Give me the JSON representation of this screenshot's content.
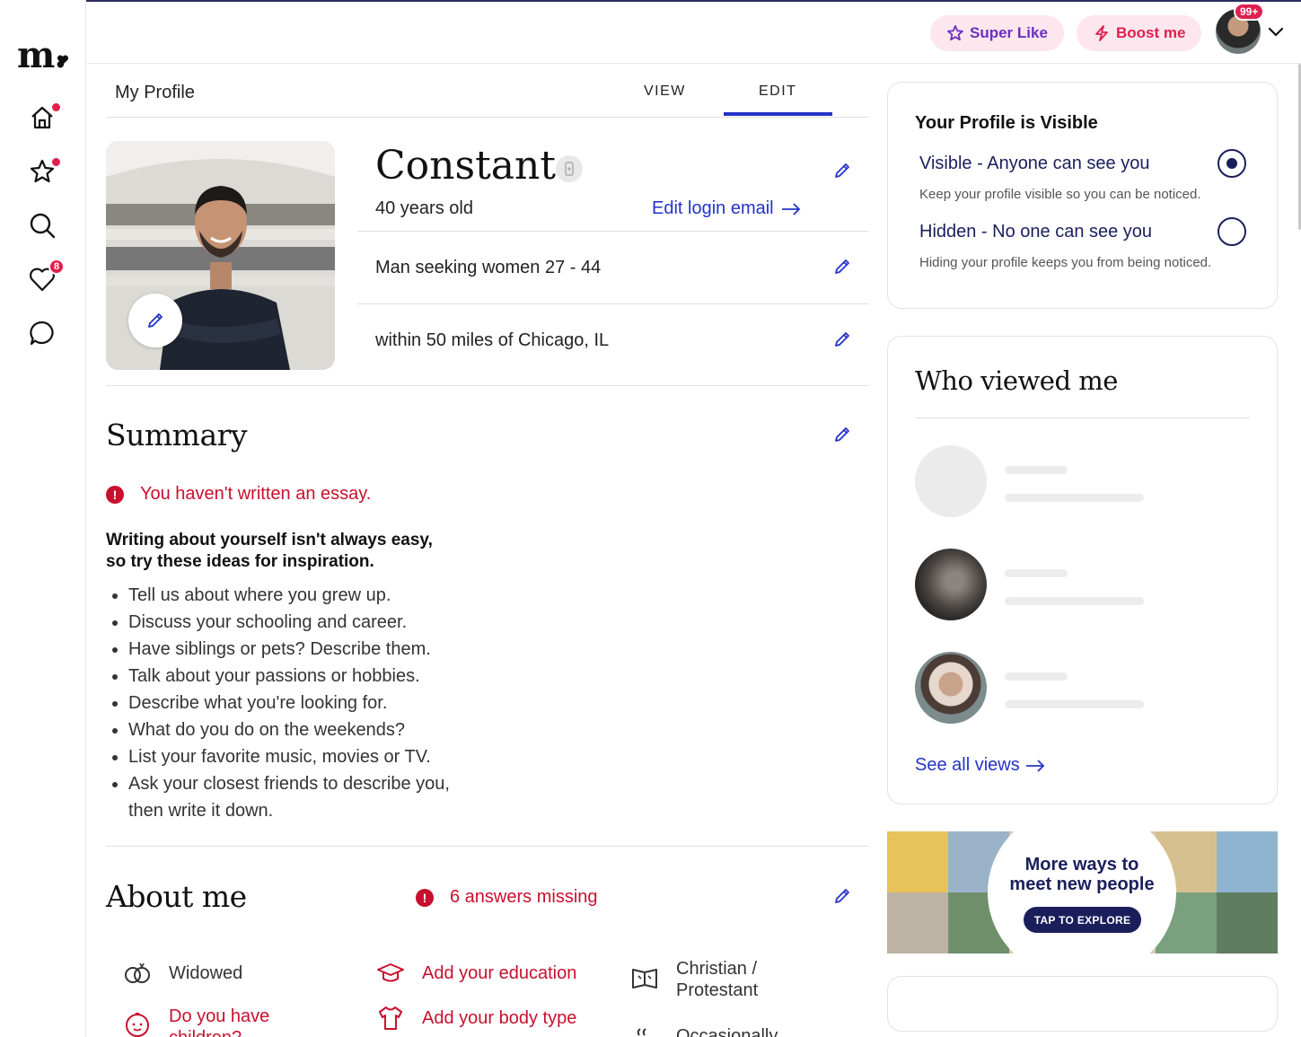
{
  "header": {
    "super_like": "Super Like",
    "boost": "Boost me",
    "avatar_badge": "99+"
  },
  "sidebar": {
    "logo": "m.",
    "likes_badge": "8",
    "items": [
      {
        "name": "home",
        "icon": "home-icon"
      },
      {
        "name": "favorites",
        "icon": "star-icon"
      },
      {
        "name": "search",
        "icon": "search-icon"
      },
      {
        "name": "likes",
        "icon": "heart-icon"
      },
      {
        "name": "messages",
        "icon": "chat-icon"
      }
    ]
  },
  "profile": {
    "page_title": "My Profile",
    "tabs": {
      "view": "VIEW",
      "edit": "EDIT",
      "active": "edit"
    },
    "name": "Constant",
    "age": "40 years old",
    "edit_login": "Edit login email",
    "seeking": "Man seeking women 27 - 44",
    "location": "within 50 miles of Chicago, IL"
  },
  "summary": {
    "title": "Summary",
    "warning": "You haven't written an essay.",
    "inspire_line1": "Writing about yourself isn't always easy,",
    "inspire_line2": "so try these ideas for inspiration.",
    "ideas": [
      "Tell us about where you grew up.",
      "Discuss your schooling and career.",
      "Have siblings or pets? Describe them.",
      "Talk about your passions or hobbies.",
      "Describe what you're looking for.",
      "What do you do on the weekends?",
      "List your favorite music, movies or TV.",
      "Ask your closest friends to describe you, then write it down."
    ]
  },
  "about": {
    "title": "About me",
    "missing": "6 answers missing",
    "items": {
      "relationship": "Widowed",
      "education": "Add your education",
      "religion_line1": "Christian /",
      "religion_line2": "Protestant",
      "children_line1": "Do you have",
      "children_line2": "children?",
      "body_type": "Add your body type",
      "habit": "Occasionally"
    }
  },
  "visibility": {
    "title": "Your Profile is Visible",
    "visible_label": "Visible - Anyone can see you",
    "visible_desc": "Keep your profile visible so you can be noticed.",
    "hidden_label": "Hidden - No one can see you",
    "hidden_desc": "Hiding your profile keeps you from being noticed.",
    "selected": "visible"
  },
  "who_viewed": {
    "title": "Who viewed me",
    "see_all": "See all views"
  },
  "promo": {
    "line1": "More ways to",
    "line2": "meet new people",
    "button": "TAP TO EXPLORE"
  },
  "colors": {
    "accent": "#2433c8",
    "alert": "#c8102e",
    "brand_pink": "#e0204e",
    "navy": "#1a1f5c",
    "super_like": "#6b2fbf"
  }
}
